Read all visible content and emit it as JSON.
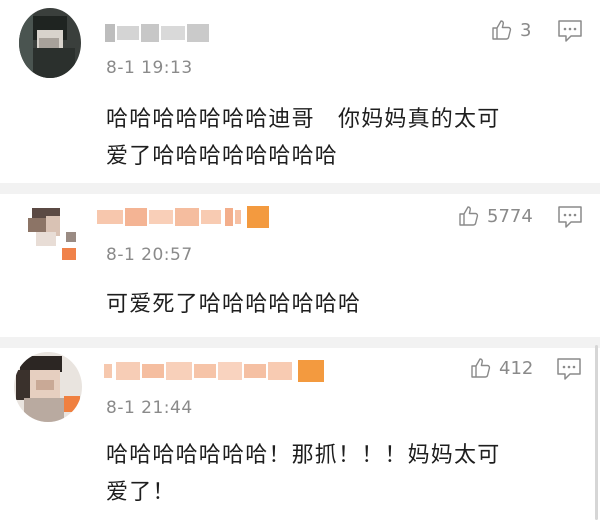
{
  "comments": [
    {
      "timestamp": "8-1 19:13",
      "likes": "3",
      "text_line1": "哈哈哈哈哈哈哈迪哥　你妈妈真的太可",
      "text_line2": "爱了哈哈哈哈哈哈哈哈",
      "name_color": "#c9c9c9"
    },
    {
      "timestamp": "8-1 20:57",
      "likes": "5774",
      "text_line1": "可爱死了哈哈哈哈哈哈哈",
      "name_color": "#f4b89a"
    },
    {
      "timestamp": "8-1 21:44",
      "likes": "412",
      "text_line1": "哈哈哈哈哈哈哈！那抓！！！妈妈太可",
      "text_line2": "爱了！",
      "name_color": "#f6c3a6"
    }
  ],
  "icons": {
    "like": "thumbs-up-icon",
    "reply": "comment-bubble-icon"
  },
  "colors": {
    "meta_text": "#8a8a8a",
    "divider": "#f2f2f2",
    "body_text": "#1e1e1e"
  }
}
